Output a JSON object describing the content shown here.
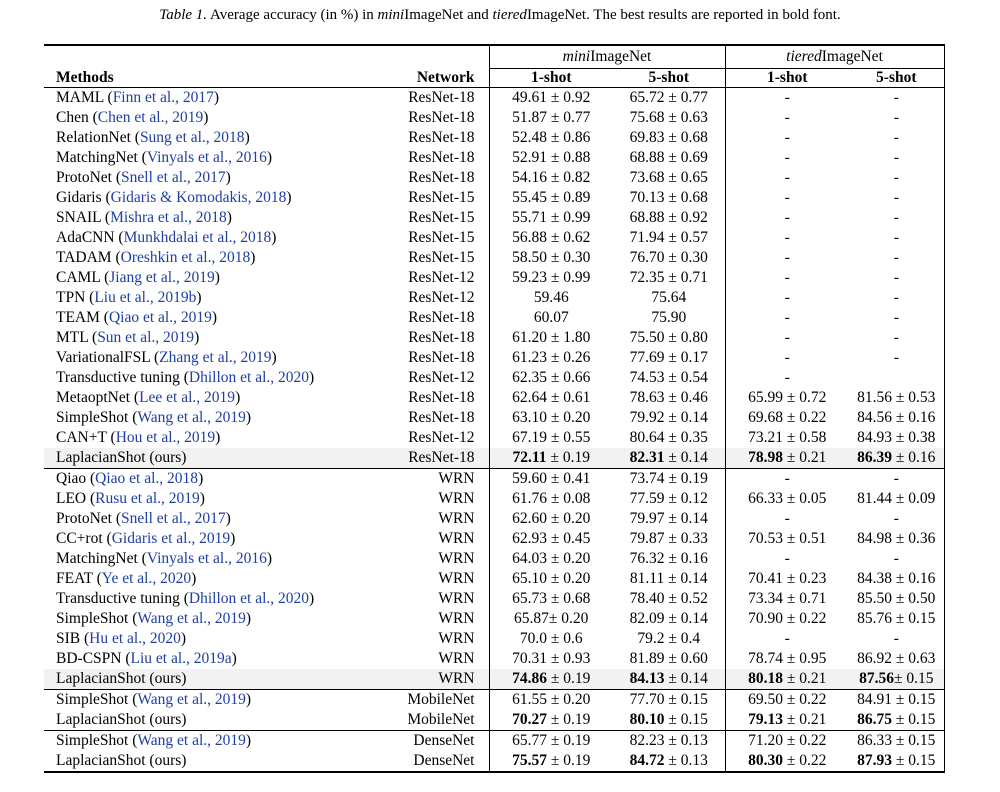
{
  "caption": {
    "label": "Table 1.",
    "text_a": "Average accuracy (in %) in ",
    "mini_prefix": "mini",
    "mini_rest": "ImageNet and ",
    "tiered_prefix": "tiered",
    "text_b": "ImageNet. The best results are reported in bold font."
  },
  "header": {
    "mini_prefix": "mini",
    "mini_rest": "ImageNet",
    "tiered_prefix": "tiered",
    "tiered_rest": "ImageNet",
    "methods": "Methods",
    "network": "Network",
    "one_shot": "1-shot",
    "five_shot": "5-shot",
    "one_shot_t": "1-shot",
    "five_shot_t": "5-shot"
  },
  "rows": [
    {
      "method": "MAML (",
      "cite": "Finn et al., 2017",
      "close": ")",
      "network": "ResNet-18",
      "m1": "49.61 ± 0.92",
      "m5": "65.72 ± 0.77",
      "t1": "-",
      "t5": "-"
    },
    {
      "method": "Chen (",
      "cite": "Chen et al., 2019",
      "close": ")",
      "network": "ResNet-18",
      "m1": "51.87 ± 0.77",
      "m5": "75.68 ± 0.63",
      "t1": "-",
      "t5": "-"
    },
    {
      "method": "RelationNet (",
      "cite": "Sung et al., 2018",
      "close": ")",
      "network": "ResNet-18",
      "m1": "52.48 ± 0.86",
      "m5": "69.83 ± 0.68",
      "t1": "-",
      "t5": "-"
    },
    {
      "method": "MatchingNet (",
      "cite": "Vinyals et al., 2016",
      "close": ")",
      "network": "ResNet-18",
      "m1": "52.91 ± 0.88",
      "m5": "68.88 ± 0.69",
      "t1": "-",
      "t5": "-"
    },
    {
      "method": "ProtoNet (",
      "cite": "Snell et al., 2017",
      "close": ")",
      "network": "ResNet-18",
      "m1": "54.16 ± 0.82",
      "m5": "73.68 ± 0.65",
      "t1": "-",
      "t5": "-"
    },
    {
      "method": "Gidaris (",
      "cite": "Gidaris & Komodakis, 2018",
      "close": ")",
      "network": "ResNet-15",
      "m1": "55.45 ± 0.89",
      "m5": "70.13 ± 0.68",
      "t1": "-",
      "t5": "-"
    },
    {
      "method": "SNAIL (",
      "cite": "Mishra et al., 2018",
      "close": ")",
      "network": "ResNet-15",
      "m1": "55.71 ± 0.99",
      "m5": "68.88 ± 0.92",
      "t1": "-",
      "t5": "-"
    },
    {
      "method": "AdaCNN (",
      "cite": "Munkhdalai et al., 2018",
      "close": ")",
      "network": "ResNet-15",
      "m1": "56.88 ± 0.62",
      "m5": "71.94 ± 0.57",
      "t1": "-",
      "t5": "-"
    },
    {
      "method": "TADAM (",
      "cite": "Oreshkin et al., 2018",
      "close": ")",
      "network": "ResNet-15",
      "m1": "58.50 ± 0.30",
      "m5": "76.70 ± 0.30",
      "t1": "-",
      "t5": "-"
    },
    {
      "method": "CAML (",
      "cite": "Jiang et al., 2019",
      "close": ")",
      "network": "ResNet-12",
      "m1": "59.23 ± 0.99",
      "m5": "72.35 ± 0.71",
      "t1": "-",
      "t5": "-"
    },
    {
      "method": "TPN (",
      "cite": "Liu et al., 2019b",
      "close": ")",
      "network": "ResNet-12",
      "m1": "59.46",
      "m5": "75.64",
      "t1": "-",
      "t5": "-"
    },
    {
      "method": "TEAM (",
      "cite": "Qiao et al., 2019",
      "close": ")",
      "network": "ResNet-18",
      "m1": "60.07",
      "m5": "75.90",
      "t1": "-",
      "t5": "-"
    },
    {
      "method": "MTL (",
      "cite": "Sun et al., 2019",
      "close": ")",
      "network": "ResNet-18",
      "m1": "61.20 ± 1.80",
      "m5": "75.50 ± 0.80",
      "t1": "-",
      "t5": "-"
    },
    {
      "method": "VariationalFSL (",
      "cite": "Zhang et al., 2019",
      "close": ")",
      "network": "ResNet-18",
      "m1": "61.23 ± 0.26",
      "m5": "77.69 ± 0.17",
      "t1": "-",
      "t5": "-"
    },
    {
      "method": "Transductive tuning (",
      "cite": "Dhillon et al., 2020",
      "close": ")",
      "network": "ResNet-12",
      "m1": "62.35 ± 0.66",
      "m5": "74.53 ± 0.54",
      "t1": "-",
      "t5": ""
    },
    {
      "method": "MetaoptNet (",
      "cite": "Lee et al., 2019",
      "close": ")",
      "network": "ResNet-18",
      "m1": "62.64 ± 0.61",
      "m5": "78.63 ± 0.46",
      "t1": "65.99 ± 0.72",
      "t5": "81.56 ± 0.53"
    },
    {
      "method": "SimpleShot (",
      "cite": "Wang et al., 2019",
      "close": ")",
      "network": "ResNet-18",
      "m1": "63.10 ± 0.20",
      "m5": "79.92 ± 0.14",
      "t1": "69.68 ± 0.22",
      "t5": "84.56 ± 0.16"
    },
    {
      "method": "CAN+T (",
      "cite": "Hou et al., 2019",
      "close": ")",
      "network": "ResNet-12",
      "m1": "67.19 ± 0.55",
      "m5": "80.64 ± 0.35",
      "t1": "73.21 ± 0.58",
      "t5": "84.93 ± 0.38"
    },
    {
      "method": "LaplacianShot (ours)",
      "cite": "",
      "close": "",
      "network": "ResNet-18",
      "m1b": "72.11",
      "m1": " ± 0.19",
      "m5b": "82.31",
      "m5": " ± 0.14",
      "t1b": "78.98",
      "t1": " ± 0.21",
      "t5b": "86.39",
      "t5": " ± 0.16"
    },
    {
      "method": "Qiao (",
      "cite": "Qiao et al., 2018",
      "close": ")",
      "network": "WRN",
      "m1": "59.60 ± 0.41",
      "m5": "73.74 ± 0.19",
      "t1": "-",
      "t5": "-"
    },
    {
      "method": "LEO (",
      "cite": "Rusu et al., 2019",
      "close": ")",
      "network": "WRN",
      "m1": "61.76 ± 0.08",
      "m5": "77.59 ± 0.12",
      "t1": "66.33 ± 0.05",
      "t5": "81.44 ± 0.09"
    },
    {
      "method": "ProtoNet (",
      "cite": "Snell et al., 2017",
      "close": ")",
      "network": "WRN",
      "m1": "62.60 ± 0.20",
      "m5": "79.97 ± 0.14",
      "t1": "-",
      "t5": "-"
    },
    {
      "method": "CC+rot (",
      "cite": "Gidaris et al., 2019",
      "close": ")",
      "network": "WRN",
      "m1": "62.93 ± 0.45",
      "m5": "79.87 ± 0.33",
      "t1": "70.53 ± 0.51",
      "t5": "84.98 ± 0.36"
    },
    {
      "method": "MatchingNet (",
      "cite": "Vinyals et al., 2016",
      "close": ")",
      "network": "WRN",
      "m1": "64.03 ± 0.20",
      "m5": "76.32 ± 0.16",
      "t1": "-",
      "t5": "-"
    },
    {
      "method": "FEAT (",
      "cite": "Ye et al., 2020",
      "close": ")",
      "network": "WRN",
      "m1": "65.10 ± 0.20",
      "m5": "81.11 ± 0.14",
      "t1": "70.41 ± 0.23",
      "t5": "84.38 ± 0.16"
    },
    {
      "method": "Transductive tuning (",
      "cite": "Dhillon et al., 2020",
      "close": ")",
      "network": "WRN",
      "m1": "65.73 ± 0.68",
      "m5": "78.40 ± 0.52",
      "t1": "73.34 ± 0.71",
      "t5": "85.50 ± 0.50"
    },
    {
      "method": "SimpleShot (",
      "cite": "Wang et al., 2019",
      "close": ")",
      "network": "WRN",
      "m1": "65.87± 0.20",
      "m5": "82.09 ± 0.14",
      "t1": "70.90 ± 0.22",
      "t5": "85.76 ± 0.15"
    },
    {
      "method": "SIB (",
      "cite": "Hu et al., 2020",
      "close": ")",
      "network": "WRN",
      "m1": "70.0 ± 0.6",
      "m5": "79.2 ± 0.4",
      "t1": "-",
      "t5": "-"
    },
    {
      "method": "BD-CSPN (",
      "cite": "Liu et al., 2019a",
      "close": ")",
      "network": "WRN",
      "m1": "70.31 ± 0.93",
      "m5": "81.89 ± 0.60",
      "t1": "78.74 ± 0.95",
      "t5": "86.92 ± 0.63"
    },
    {
      "method": "LaplacianShot (ours)",
      "cite": "",
      "close": "",
      "network": "WRN",
      "m1b": "74.86",
      "m1": " ± 0.19",
      "m5b": "84.13",
      "m5": " ± 0.14",
      "t1b": "80.18",
      "t1": " ± 0.21",
      "t5b": "87.56",
      "t5": "± 0.15"
    },
    {
      "method": "SimpleShot (",
      "cite": "Wang et al., 2019",
      "close": ")",
      "network": "MobileNet",
      "m1": "61.55 ± 0.20",
      "m5": "77.70 ± 0.15",
      "t1": "69.50 ± 0.22",
      "t5": "84.91 ± 0.15"
    },
    {
      "method": "LaplacianShot (ours)",
      "cite": "",
      "close": "",
      "network": "MobileNet",
      "m1b": "70.27",
      "m1": " ± 0.19",
      "m5b": "80.10",
      "m5": " ± 0.15",
      "t1b": "79.13",
      "t1": " ± 0.21",
      "t5b": "86.75",
      "t5": " ± 0.15"
    },
    {
      "method": "SimpleShot (",
      "cite": "Wang et al., 2019",
      "close": ")",
      "network": "DenseNet",
      "m1": "65.77 ± 0.19",
      "m5": "82.23 ± 0.13",
      "t1": "71.20 ± 0.22",
      "t5": "86.33 ± 0.15"
    },
    {
      "method": "LaplacianShot (ours)",
      "cite": "",
      "close": "",
      "network": "DenseNet",
      "m1b": "75.57",
      "m1": " ± 0.19",
      "m5b": "84.72",
      "m5": " ± 0.13",
      "t1b": "80.30",
      "t1": " ± 0.22",
      "t5b": "87.93",
      "t5": " ± 0.15"
    }
  ]
}
